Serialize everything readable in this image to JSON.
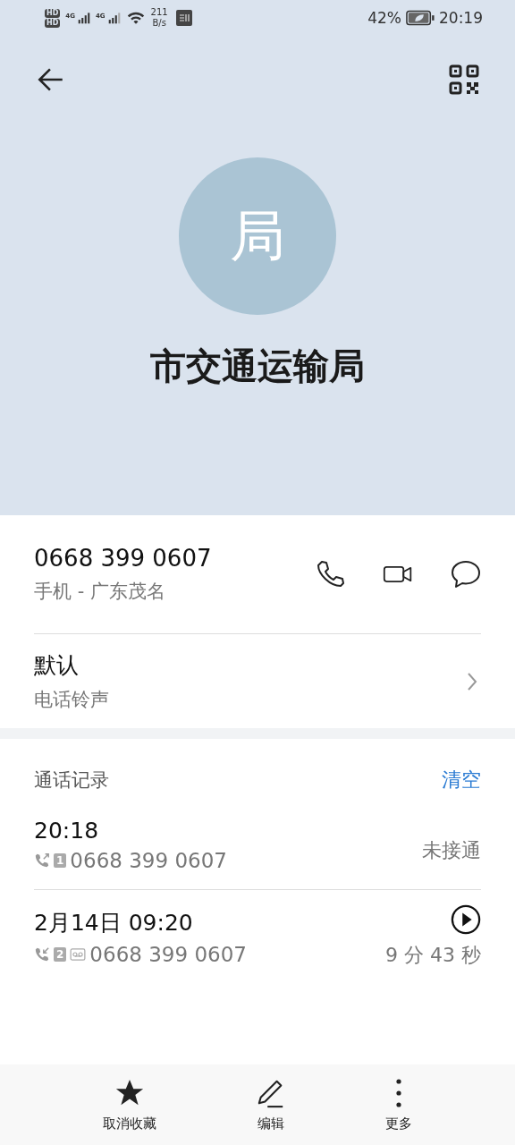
{
  "status_bar": {
    "hd": [
      "HD",
      "HD"
    ],
    "network": [
      "4G",
      "4G"
    ],
    "speed": [
      "211",
      "B/s"
    ],
    "battery": "42%",
    "time": "20:19"
  },
  "contact": {
    "avatar_letter": "局",
    "name": "市交通运输局"
  },
  "phone": {
    "number": "0668 399 0607",
    "label": "手机 - 广东茂名"
  },
  "ringtone": {
    "value": "默认",
    "label": "电话铃声"
  },
  "call_log": {
    "title": "通话记录",
    "clear": "清空",
    "entries": [
      {
        "time": "20:18",
        "kind": "outgoing",
        "sim": "1",
        "recorded": false,
        "number": "0668 399 0607",
        "status": "未接通"
      },
      {
        "time": "2月14日 09:20",
        "kind": "incoming",
        "sim": "2",
        "recorded": true,
        "number": "0668 399 0607",
        "status": "9 分 43 秒"
      }
    ]
  },
  "bottom_bar": [
    {
      "kind": "star",
      "label": "取消收藏"
    },
    {
      "kind": "edit",
      "label": "编辑"
    },
    {
      "kind": "more",
      "label": "更多"
    }
  ]
}
